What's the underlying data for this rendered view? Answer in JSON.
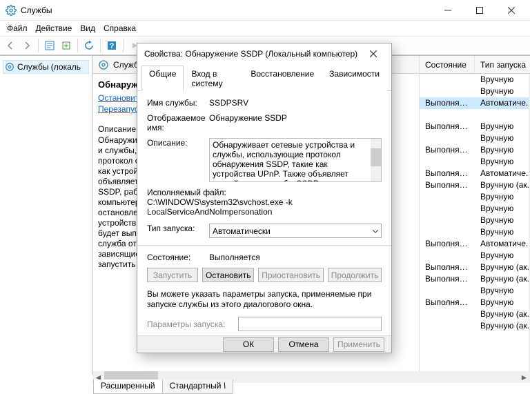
{
  "app": {
    "title": "Службы"
  },
  "menubar": [
    "Файл",
    "Действие",
    "Вид",
    "Справка"
  ],
  "left_pane": {
    "item": "Службы (локаль"
  },
  "center": {
    "header": "Службы",
    "service_title": "Обнаружен",
    "links": {
      "stop": "Остановить",
      "restart": "Перезапусти"
    },
    "desc_label": "Описание:",
    "desc_text": "Обнаружива\nи службы, и\nпротокол об\nкак устройс\nобъявляет у\nSSDP, работа\nкомпьютере\nостановлена\nустройств, и\nбудет выпол\nслужба откл\nзависящие с\nзапустить не"
  },
  "columns": {
    "state_header": "Состояние",
    "launch_header": "Тип запуска",
    "rows": [
      {
        "state": "",
        "launch": "Вручную"
      },
      {
        "state": "",
        "launch": "Вручную"
      },
      {
        "state": "Выполняется",
        "launch": "Автоматиче...",
        "selected": true
      },
      {
        "state": "",
        "launch": ""
      },
      {
        "state": "Выполняется",
        "launch": "Вручную"
      },
      {
        "state": "",
        "launch": "Вручную"
      },
      {
        "state": "Выполняется",
        "launch": "Вручную"
      },
      {
        "state": "",
        "launch": "Вручную"
      },
      {
        "state": "Выполняется",
        "launch": "Автоматиче..."
      },
      {
        "state": "Выполняется",
        "launch": "Вручную (ак..."
      },
      {
        "state": "",
        "launch": "Вручную"
      },
      {
        "state": "",
        "launch": "Вручную"
      },
      {
        "state": "",
        "launch": "Вручную"
      },
      {
        "state": "",
        "launch": "Вручную"
      },
      {
        "state": "Выполняется",
        "launch": "Автоматиче..."
      },
      {
        "state": "",
        "launch": "Вручную"
      },
      {
        "state": "Выполняется",
        "launch": "Вручную (ак..."
      },
      {
        "state": "Выполняется",
        "launch": "Вручную (ак..."
      },
      {
        "state": "",
        "launch": "Вручную"
      },
      {
        "state": "Выполняется",
        "launch": "Вручную"
      },
      {
        "state": "",
        "launch": "Вручную (ак..."
      },
      {
        "state": "",
        "launch": "Вручную (ак..."
      }
    ]
  },
  "footer_tabs": {
    "extended": "Расширенный",
    "standard": "Стандартный"
  },
  "dlg": {
    "title": "Свойства: Обнаружение SSDP (Локальный компьютер)",
    "tabs": [
      "Общие",
      "Вход в систему",
      "Восстановление",
      "Зависимости"
    ],
    "lbl_service_name": "Имя службы:",
    "val_service_name": "SSDPSRV",
    "lbl_display_name": "Отображаемое имя:",
    "val_display_name": "Обнаружение SSDP",
    "lbl_desc": "Описание:",
    "val_desc": "Обнаруживает сетевые устройства и службы, использующие протокол обнаружения SSDP, такие как устройства UPnP. Также объявляет устройства и службы SSDP, работающие на",
    "lbl_exe": "Исполняемый файл:",
    "val_exe": "C:\\WINDOWS\\system32\\svchost.exe -k LocalServiceAndNoImpersonation",
    "lbl_startup": "Тип запуска:",
    "val_startup": "Автоматически",
    "lbl_state": "Состояние:",
    "val_state": "Выполняется",
    "btn_start": "Запустить",
    "btn_stop": "Остановить",
    "btn_pause": "Приостановить",
    "btn_resume": "Продолжить",
    "help_text": "Вы можете указать параметры запуска, применяемые при запуске службы из этого диалогового окна.",
    "lbl_params": "Параметры запуска:",
    "val_params": "",
    "btn_ok": "ОК",
    "btn_cancel": "Отмена",
    "btn_apply": "Применить"
  }
}
